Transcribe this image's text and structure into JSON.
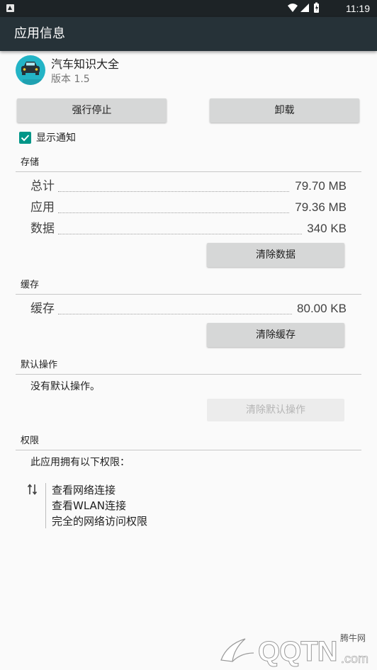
{
  "status_bar": {
    "time": "11:19"
  },
  "app_bar": {
    "title": "应用信息"
  },
  "app": {
    "name": "汽车知识大全",
    "version": "版本 1.5",
    "icon_color": "#23b4c6"
  },
  "buttons": {
    "force_stop": "强行停止",
    "uninstall": "卸载"
  },
  "notification": {
    "label": "显示通知",
    "checked": true
  },
  "storage": {
    "header": "存储",
    "rows": [
      {
        "label": "总计",
        "value": "79.70 MB"
      },
      {
        "label": "应用",
        "value": "79.36 MB"
      },
      {
        "label": "数据",
        "value": "340 KB"
      }
    ],
    "clear_button": "清除数据"
  },
  "cache": {
    "header": "缓存",
    "row": {
      "label": "缓存",
      "value": "80.00 KB"
    },
    "clear_button": "清除缓存"
  },
  "defaults": {
    "header": "默认操作",
    "text": "没有默认操作。",
    "clear_button": "清除默认操作"
  },
  "permissions": {
    "header": "权限",
    "intro": "此应用拥有以下权限：",
    "items": [
      "查看网络连接",
      "查看WLAN连接",
      "完全的网络访问权限"
    ]
  },
  "watermark": {
    "text": "QQTN",
    "site_label": "腾牛网",
    "suffix": ".com"
  },
  "colors": {
    "app_bar": "#263238",
    "status_bar": "#1d2326",
    "accent": "#009688"
  }
}
